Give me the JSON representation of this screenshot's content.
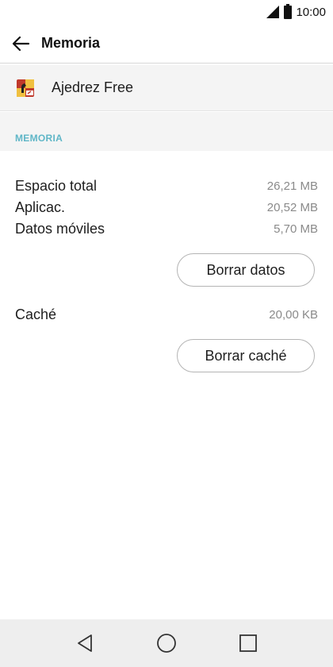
{
  "status_bar": {
    "time": "10:00",
    "signal_icon": "signal-icon",
    "battery_icon": "battery-icon"
  },
  "app_bar": {
    "title": "Memoria",
    "back_icon": "arrow-back-icon"
  },
  "app_info": {
    "name": "Ajedrez Free",
    "icon": "chess-app-icon"
  },
  "section": {
    "header": "MEMORIA"
  },
  "storage": {
    "rows": [
      {
        "label": "Espacio total",
        "value": "26,21 MB"
      },
      {
        "label": "Aplicac.",
        "value": "20,52 MB"
      },
      {
        "label": "Datos móviles",
        "value": "5,70 MB"
      }
    ],
    "clear_data_label": "Borrar datos"
  },
  "cache": {
    "label": "Caché",
    "value": "20,00 KB",
    "clear_cache_label": "Borrar caché"
  },
  "nav_bar": {
    "back_icon": "nav-back-icon",
    "home_icon": "nav-home-icon",
    "recents_icon": "nav-recents-icon"
  },
  "colors": {
    "accent": "#5fb6c7",
    "section_bg": "#f4f4f4",
    "nav_bg": "#eeeeee"
  }
}
